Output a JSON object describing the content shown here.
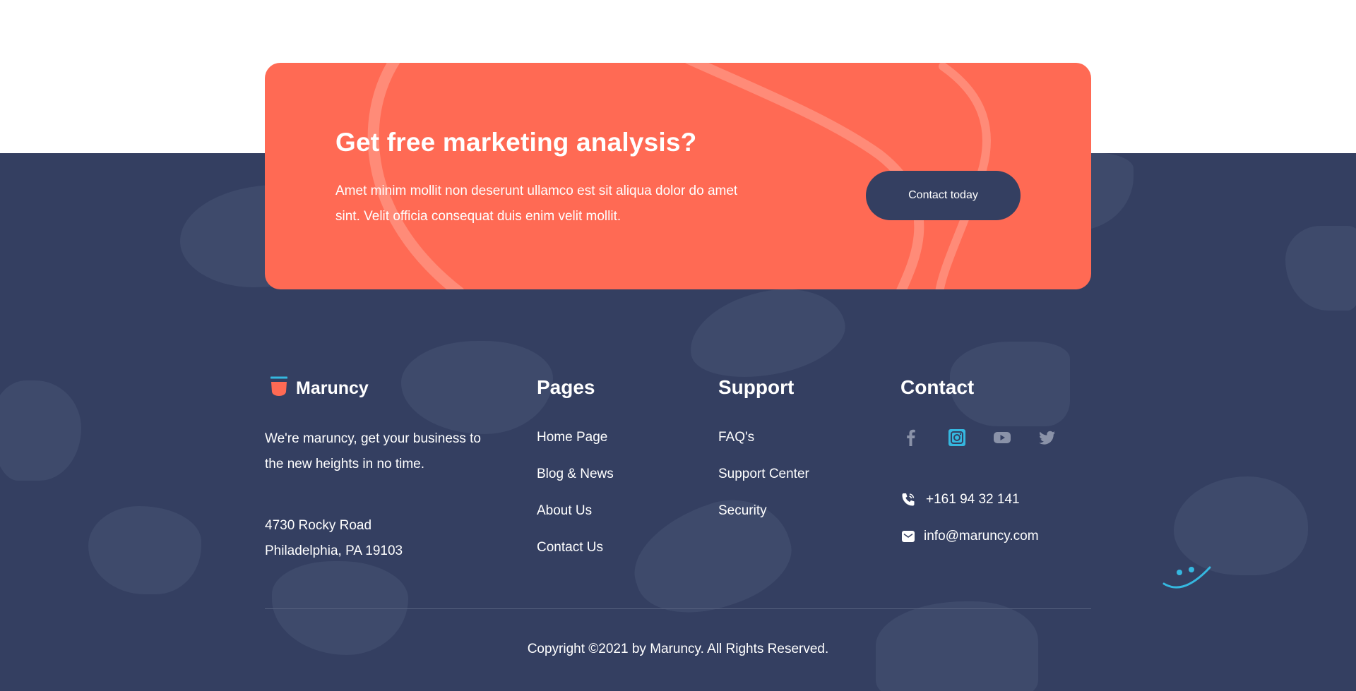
{
  "cta": {
    "title": "Get free marketing analysis?",
    "text": "Amet minim mollit non deserunt ullamco est sit aliqua dolor do amet sint. Velit officia consequat duis enim velit mollit.",
    "button_label": "Contact today",
    "color": "#ff6a54"
  },
  "brand": {
    "name": "Maruncy",
    "description": "We're maruncy, get your business to the new heights in no time.",
    "address_line1": "4730 Rocky Road",
    "address_line2": "Philadelphia, PA 19103"
  },
  "pages": {
    "title": "Pages",
    "links": [
      "Home Page",
      "Blog & News",
      "About Us",
      "Contact Us"
    ]
  },
  "support": {
    "title": "Support",
    "links": [
      "FAQ's",
      "Support Center",
      "Security"
    ]
  },
  "contact": {
    "title": "Contact",
    "social": [
      "facebook-icon",
      "instagram-icon",
      "youtube-icon",
      "twitter-icon"
    ],
    "phone": "+161  94 32 141",
    "email": "info@maruncy.com"
  },
  "footer": {
    "copyright": "Copyright ©2021  by Maruncy. All Rights Reserved.",
    "background": "#343f61",
    "accent": "#35b8e0"
  }
}
